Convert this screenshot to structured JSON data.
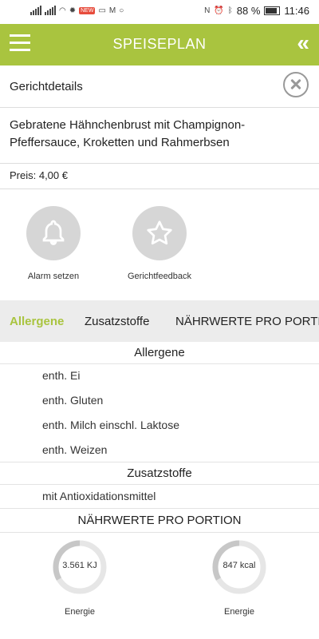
{
  "status_bar": {
    "battery_text": "88 %",
    "time": "11:46",
    "notif_badge": "NEW"
  },
  "header": {
    "title": "SPEISEPLAN",
    "menu_icon": "hamburger-icon",
    "back_icon": "double-chevron-left-icon"
  },
  "detail": {
    "section_label": "Gerichtdetails",
    "dish_name": "Gebratene Hähnchenbrust mit Champignon-Pfeffersauce, Kroketten und Rahmerbsen",
    "price": "Preis: 4,00 €"
  },
  "actions": [
    {
      "label": "Alarm setzen",
      "icon": "bell-icon"
    },
    {
      "label": "Gerichtfeedback",
      "icon": "star-icon"
    }
  ],
  "tabs": [
    {
      "label": "Allergene",
      "active": true
    },
    {
      "label": "Zusatzstoffe",
      "active": false
    },
    {
      "label": "NÄHRWERTE PRO PORTION",
      "active": false
    }
  ],
  "allergens": {
    "title": "Allergene",
    "items": [
      "enth. Ei",
      "enth. Gluten",
      "enth. Milch einschl. Laktose",
      "enth. Weizen"
    ]
  },
  "additives": {
    "title": "Zusatzstoffe",
    "items": [
      "mit Antioxidationsmittel"
    ]
  },
  "nutrition": {
    "title": "NÄHRWERTE PRO PORTION",
    "entries": [
      {
        "value": "3.561 KJ",
        "label": "Energie"
      },
      {
        "value": "847 kcal",
        "label": "Energie"
      }
    ]
  },
  "colors": {
    "accent": "#a9c43f",
    "tab_bg": "#ececec",
    "circle_bg": "#d6d6d6"
  }
}
